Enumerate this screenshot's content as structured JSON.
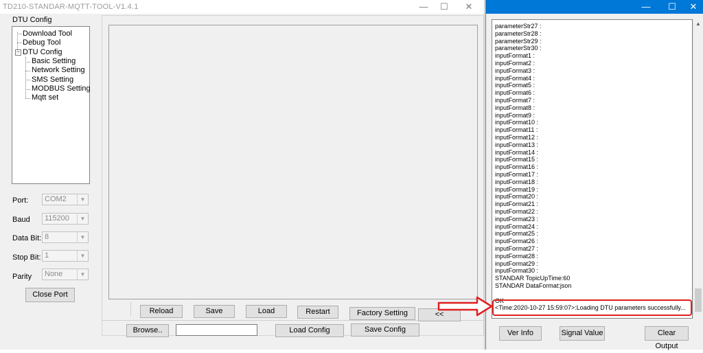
{
  "main_window": {
    "title": "TD210-STANDAR-MQTT-TOOL-V1.4.1",
    "controls": {
      "minimize": "—",
      "maximize": "☐",
      "close": "✕"
    }
  },
  "tree": {
    "label": "DTU Config",
    "items": [
      "Download Tool",
      "Debug Tool",
      "DTU Config",
      "Basic Setting",
      "Network Setting",
      "SMS Setting",
      "MODBUS Setting",
      "Mqtt set"
    ]
  },
  "port_settings": {
    "port_label": "Port:",
    "port_value": "COM2",
    "baud_label": "Baud",
    "baud_value": "115200",
    "databit_label": "Data Bit:",
    "databit_value": "8",
    "stopbit_label": "Stop Bit:",
    "stopbit_value": "1",
    "parity_label": "Parity",
    "parity_value": "None",
    "close_port": "Close Port"
  },
  "buttons": {
    "reload": "Reload",
    "save": "Save",
    "load": "Load",
    "restart": "Restart",
    "factory": "Factory Setting",
    "collapse": "<<",
    "browse": "Browse..",
    "load_config": "Load Config",
    "save_config": "Save Config"
  },
  "output_window": {
    "controls": {
      "minimize": "—",
      "maximize": "☐",
      "close": "✕"
    },
    "lines": [
      "parameterStr27 :",
      "parameterStr28 :",
      "parameterStr29 :",
      "parameterStr30 :",
      "inputFormat1 :",
      "inputFormat2 :",
      "inputFormat3 :",
      "inputFormat4 :",
      "inputFormat5 :",
      "inputFormat6 :",
      "inputFormat7 :",
      "inputFormat8 :",
      "inputFormat9 :",
      "inputFormat10 :",
      "inputFormat11 :",
      "inputFormat12 :",
      "inputFormat13 :",
      "inputFormat14 :",
      "inputFormat15 :",
      "inputFormat16 :",
      "inputFormat17 :",
      "inputFormat18 :",
      "inputFormat19 :",
      "inputFormat20 :",
      "inputFormat21 :",
      "inputFormat22 :",
      "inputFormat23 :",
      "inputFormat24 :",
      "inputFormat25 :",
      "inputFormat26 :",
      "inputFormat27 :",
      "inputFormat28 :",
      "inputFormat29 :",
      "inputFormat30 :",
      "STANDAR TopicUpTime:60",
      "STANDAR DataFormat:json",
      "",
      "OK",
      "<Time:2020-10-27 15:59:07>:Loading DTU parameters successfully..."
    ],
    "ver_info": "Ver Info",
    "signal_value": "Signal Value",
    "clear_output": "Clear Output"
  },
  "colors": {
    "highlight": "#e02020",
    "titlebar_active": "#0078d7"
  }
}
